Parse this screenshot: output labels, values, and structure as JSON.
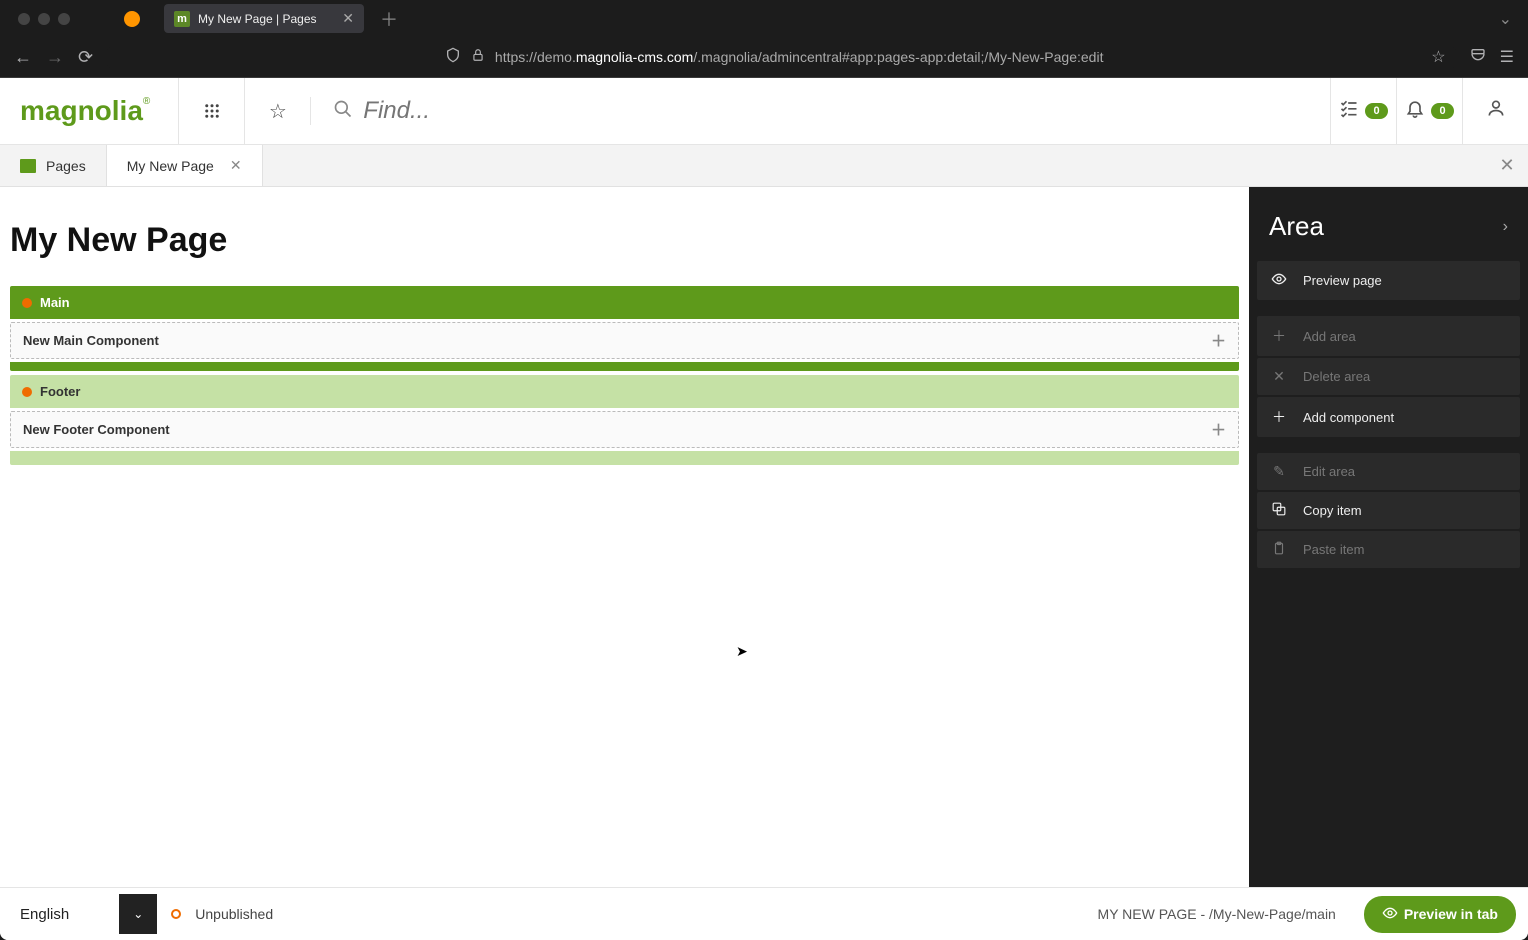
{
  "browser": {
    "tab_title": "My New Page | Pages",
    "url_prefix": "https://demo.",
    "url_domain": "magnolia-cms.com",
    "url_suffix": "/.magnolia/admincentral#app:pages-app:detail;/My-New-Page:edit"
  },
  "header": {
    "logo": "magnolia",
    "search_placeholder": "Find...",
    "tasks_count": "0",
    "notifications_count": "0"
  },
  "tabs": {
    "root": "Pages",
    "active": "My New Page"
  },
  "page": {
    "title": "My New Page",
    "areas": [
      {
        "label": "Main",
        "component_label": "New Main Component",
        "active": true
      },
      {
        "label": "Footer",
        "component_label": "New Footer Component",
        "active": false
      }
    ]
  },
  "side_panel": {
    "title": "Area",
    "actions": [
      {
        "icon": "eye-icon",
        "label": "Preview page",
        "enabled": true
      },
      {
        "sep": true
      },
      {
        "icon": "plus-icon",
        "label": "Add area",
        "enabled": false
      },
      {
        "icon": "x-icon",
        "label": "Delete area",
        "enabled": false
      },
      {
        "icon": "plus-icon",
        "label": "Add component",
        "enabled": true
      },
      {
        "sep": true
      },
      {
        "icon": "pencil-icon",
        "label": "Edit area",
        "enabled": false
      },
      {
        "icon": "copy-icon",
        "label": "Copy item",
        "enabled": true
      },
      {
        "icon": "clipboard-icon",
        "label": "Paste item",
        "enabled": false
      }
    ]
  },
  "status_bar": {
    "language": "English",
    "publish_status": "Unpublished",
    "path": "MY NEW PAGE - /My-New-Page/main",
    "preview_button": "Preview in tab"
  }
}
